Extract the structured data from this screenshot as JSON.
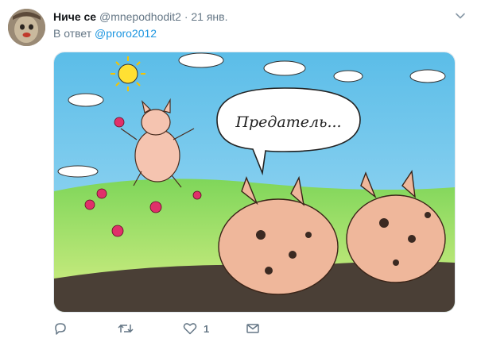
{
  "tweet": {
    "author_name": "Ниче се",
    "author_handle": "@mnepodhodit2",
    "separator": "·",
    "timestamp": "21 янв.",
    "reply_prefix": "В ответ",
    "reply_to": "@proro2012"
  },
  "media": {
    "speech_text": "Предатель..."
  },
  "actions": {
    "like_count": "1"
  },
  "icons": [
    "avatar",
    "chevron-down-icon",
    "reply-icon",
    "retweet-icon",
    "heart-icon",
    "message-icon"
  ],
  "colors": {
    "link": "#1b95e0",
    "secondary_text": "#657786",
    "sky": "#74c7ec",
    "grass": "#6fcf4d",
    "mud": "#4a3f36",
    "pig": "#f2b7a0"
  }
}
